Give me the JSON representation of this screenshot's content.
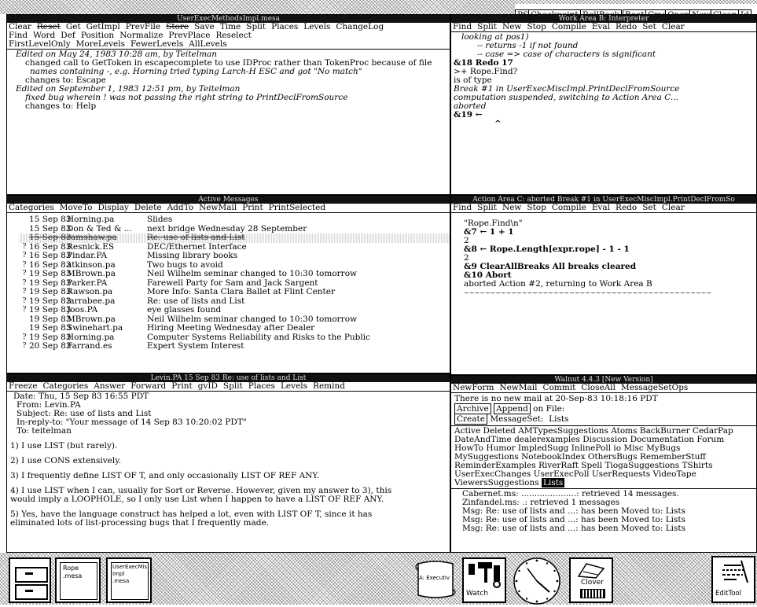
{
  "top_buttons": [
    "PS",
    "Checkpoint",
    "RollBack",
    "Boot",
    "Cmd",
    "Open",
    "New",
    "Clean",
    "Id"
  ],
  "method_window": {
    "title": "UserExecMethodsImpl.mesa",
    "menu1": [
      "Clear",
      "Reset",
      "Get",
      "GetImpl",
      "PrevFile",
      "Store",
      "Save",
      "Time",
      "Split",
      "Places",
      "Levels",
      "ChangeLog"
    ],
    "menu2": [
      "Find",
      "Word",
      "Def",
      "Position",
      "Normalize",
      "PrevPlace",
      "Reselect"
    ],
    "menu3": [
      "FirstLevelOnly",
      "MoreLevels",
      "FewerLevels",
      "AllLevels"
    ],
    "lines": [
      "Edited on May 24, 1983 10:28 am, by Teitelman",
      "changed call to GetToken in escapecomplete to use IDProc rather than TokenProc because of file",
      "names containing -, e.g. Horning tried typing Larch-H ESC and got \"No match\"",
      "changes to: Escape",
      "Edited on September 1, 1983 12:51 pm, by Teitelman",
      "fixed bug wherein ! was not passing the right string to PrintDeclFromSource",
      "changes to: Help"
    ]
  },
  "work_area": {
    "title": "Work Area B: Interpreter",
    "menu": [
      "Find",
      "Split",
      "New",
      "Stop",
      "Compile",
      "Eval",
      "Redo",
      "Set",
      "Clear"
    ],
    "lines": [
      "looking at pos1)",
      "-- returns -1 if not found",
      "-- case => case of characters is significant",
      "",
      "&18 Redo 17",
      ">+ Rope.Find?",
      "is of type",
      "Break #1 in UserExecMiscImpl.PrintDeclFromSource",
      "computation suspended, switching to Action Area C...",
      "aborted",
      "&19 ←"
    ]
  },
  "active_messages": {
    "title": "Active Messages",
    "menu": [
      "Categories",
      "MoveTo",
      "Display",
      "Delete",
      "AddTo",
      "NewMail",
      "Print",
      "PrintSelected"
    ],
    "rows": [
      {
        "mark": "",
        "date": "15 Sep 83",
        "from": "Horning.pa",
        "subject": "Slides"
      },
      {
        "mark": "",
        "date": "15 Sep 83",
        "from": "Don & Ted & ...",
        "subject": "next bridge Wednesday 28 September"
      },
      {
        "mark": "",
        "date": "15 Sep 83",
        "from": "ramshaw.pa",
        "subject": "Re: use of lists and List"
      },
      {
        "mark": "?",
        "date": "16 Sep 83",
        "from": "Resnick.ES",
        "subject": "DEC/Ethernet Interface"
      },
      {
        "mark": "?",
        "date": "16 Sep 83",
        "from": "Pindar.PA",
        "subject": "Missing library books"
      },
      {
        "mark": "?",
        "date": "16 Sep 83",
        "from": "atkinson.pa",
        "subject": "Two bugs to avoid"
      },
      {
        "mark": "?",
        "date": "19 Sep 83",
        "from": "MBrown.pa",
        "subject": "Neil Wilhelm seminar changed to 10:30 tomorrow"
      },
      {
        "mark": "?",
        "date": "19 Sep 83",
        "from": "Parker.PA",
        "subject": "Farewell Party for Sam and Jack Sargent"
      },
      {
        "mark": "?",
        "date": "19 Sep 83",
        "from": "Rawson.pa",
        "subject": "More Info: Santa Clara Ballet at Flint Center"
      },
      {
        "mark": "?",
        "date": "19 Sep 83",
        "from": "larrabee.pa",
        "subject": "Re: use of lists and List"
      },
      {
        "mark": "?",
        "date": "19 Sep 83",
        "from": "Joos.PA",
        "subject": "eye glasses found"
      },
      {
        "mark": "",
        "date": "19 Sep 83",
        "from": "MBrown.pa",
        "subject": "Neil Wilhelm seminar changed to 10:30 tomorrow"
      },
      {
        "mark": "",
        "date": "19 Sep 83",
        "from": "Swinehart.pa",
        "subject": "Hiring Meeting Wednesday after Dealer"
      },
      {
        "mark": "?",
        "date": "19 Sep 83",
        "from": "Horning.pa",
        "subject": "Computer Systems Reliability and Risks to the Public"
      },
      {
        "mark": "?",
        "date": "20 Sep 83",
        "from": "Farrand.es",
        "subject": "Expert System Interest"
      }
    ]
  },
  "action_area": {
    "title": "Action Area C: aborted Break #1 in UserExecMiscImpl.PrintDeclFromSo",
    "menu": [
      "Find",
      "Split",
      "New",
      "Stop",
      "Compile",
      "Eval",
      "Redo",
      "Set",
      "Clear"
    ],
    "lines": [
      "\"Rope.Find\\n\"",
      "&7 ← 1 + 1",
      "2",
      "&8 ← Rope.Length[expr.rope] - 1 - 1",
      "2",
      "&9 ClearAllBreaks          All breaks cleared",
      "&10 Abort",
      "aborted Action #2, returning to Work Area B",
      "~~~~~~~~~~~~~~~~~~~~~~~~~~~~~~~~~~~~~~~~~~~~~~~"
    ]
  },
  "message_window": {
    "title": "Levin.PA  15 Sep 83  Re: use of lists and List",
    "menu": [
      "Freeze",
      "Categories",
      "Answer",
      "Forward",
      "Print",
      "gvID",
      "Split",
      "Places",
      "Levels",
      "Remind"
    ],
    "lines": [
      "Date: Thu, 15 Sep 83 16:55 PDT",
      "From: Levin.PA",
      "Subject: Re: use of lists and List",
      "In-reply-to: \"Your message of 14 Sep 83 10:20:02 PDT\"",
      "To: teitelman",
      "",
      "1)  I use LIST (but rarely).",
      "",
      "2)  I use CONS extensively.",
      "",
      "3)  I frequently define LIST OF T, and only occasionally LIST OF REF ANY.",
      "",
      "4)  I use LIST when I can, usually for Sort or Reverse.  However, given my answer to 3), this",
      "would imply a LOOPHOLE, so I only use List when I happen to have a LIST OF REF ANY.",
      "",
      "5)  Yes, have the language construct has helped a lot, even with LIST OF T, since it has",
      "eliminated lots of list-processing bugs that I frequently made."
    ]
  },
  "walnut": {
    "title": "Walnut 4.4.3  [New Version]",
    "menu": [
      "NewForm",
      "NewMail",
      "Commit",
      "CloseAll",
      "MessageSetOps"
    ],
    "status": "There is no new mail at 20-Sep-83 10:18:16 PDT",
    "archive": "Archive",
    "append": "Append",
    "on_file": "on File:",
    "create": "Create",
    "msgset_label": "MessageSet:",
    "msgset_value": "Lists",
    "sets": [
      [
        "Active",
        "Deleted",
        "AMTypesSuggestions",
        "Atoms",
        "BackBurner",
        "CedarPap"
      ],
      [
        "DateAndTime",
        "dealerexamples",
        "Discussion",
        "Documentation",
        "Forum"
      ],
      [
        "HowTo",
        "Humor",
        "ImpledSugg",
        "InlinePoll",
        "io",
        "Misc",
        "MyBugs"
      ],
      [
        "MySuggestions",
        "NotebookIndex",
        "OthersBugs",
        "RememberStuff"
      ],
      [
        "ReminderExamples",
        "RiverRaft",
        "Spell",
        "TiogaSuggestions",
        "TShirts"
      ],
      [
        "UserExecChanges",
        "UserExecPoll",
        "UserRequests",
        "VideoTape"
      ],
      [
        "ViewersSuggestions",
        "Lists"
      ]
    ],
    "log": [
      "Cabernet.ms: .....................: retrieved 14 messages.",
      "Zinfandel.ms: .: retrieved 1 messages",
      "Msg: Re: use of lists and  ...: has been Moved to: Lists",
      "Msg: Re: use of lists and  ...: has been Moved to: Lists",
      "Msg: Re: use of lists and  ...: has been Moved to: Lists"
    ]
  },
  "icons": {
    "rope_label1": "Rope",
    "rope_label2": ".mesa",
    "userexec_label1": "UserExecMis",
    "userexec_label2": "Impl",
    "userexec_label3": ".mesa",
    "scroll_label": "A: Executiv",
    "watch_label": "Watch",
    "clover_label": "Clover",
    "edittool_label": "EditTool"
  }
}
